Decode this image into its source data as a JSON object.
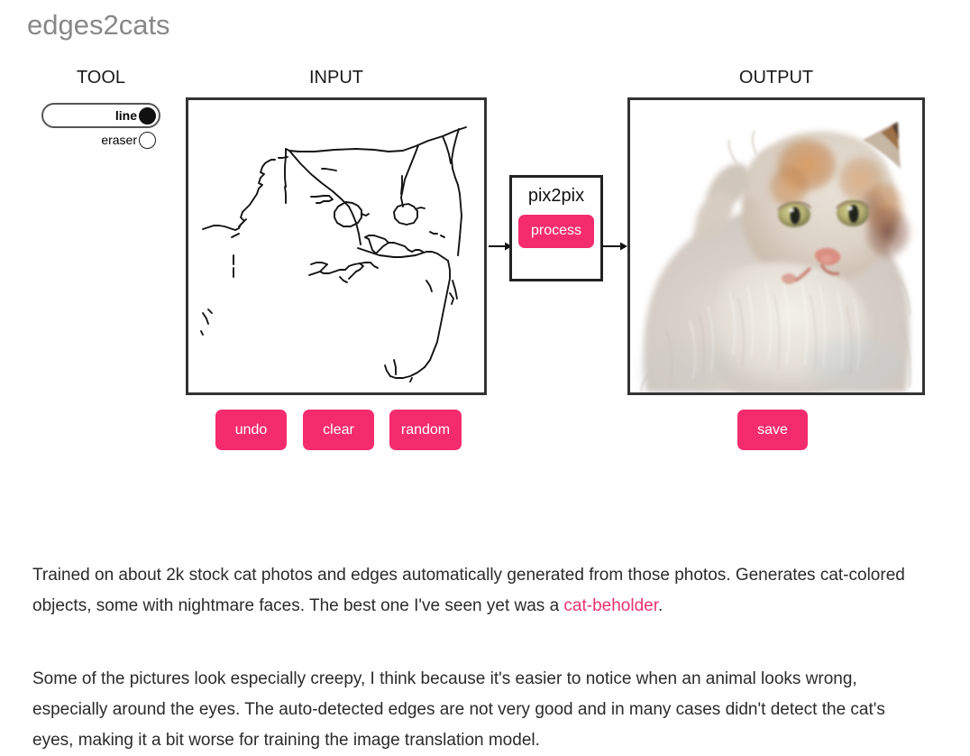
{
  "app": {
    "title": "edges2cats"
  },
  "headings": {
    "tool": "TOOL",
    "input": "INPUT",
    "output": "OUTPUT"
  },
  "tool": {
    "options": [
      {
        "label": "line",
        "selected": true
      },
      {
        "label": "eraser",
        "selected": false
      }
    ]
  },
  "pix2pix": {
    "label": "pix2pix",
    "process_label": "process"
  },
  "actions": {
    "undo": "undo",
    "clear": "clear",
    "random": "random",
    "save": "save"
  },
  "body": {
    "paragraph_1_part_1": "Trained on about 2k stock cat photos and edges automatically generated from those photos. Generates cat-colored objects, some with nightmare faces. The best one I've seen yet was a ",
    "paragraph_1_link": "cat-beholder",
    "paragraph_1_part_2": ".",
    "paragraph_2": "Some of the pictures look especially creepy, I think because it's easier to notice when an animal looks wrong, especially around the eyes. The auto-detected edges are not very good and in many cases didn't detect the cat's eyes, making it a bit worse for training the image translation model."
  },
  "colors": {
    "accent_pink": "#F42C6E",
    "link_pink": "#E8336D",
    "title_gray": "#888888",
    "frame_dark": "#333333"
  },
  "canvas": {
    "input_description": "hand-drawn black edge sketch of a cat face on white background",
    "output_description": "generated fluffy cream and ginger cat photo on white background"
  }
}
